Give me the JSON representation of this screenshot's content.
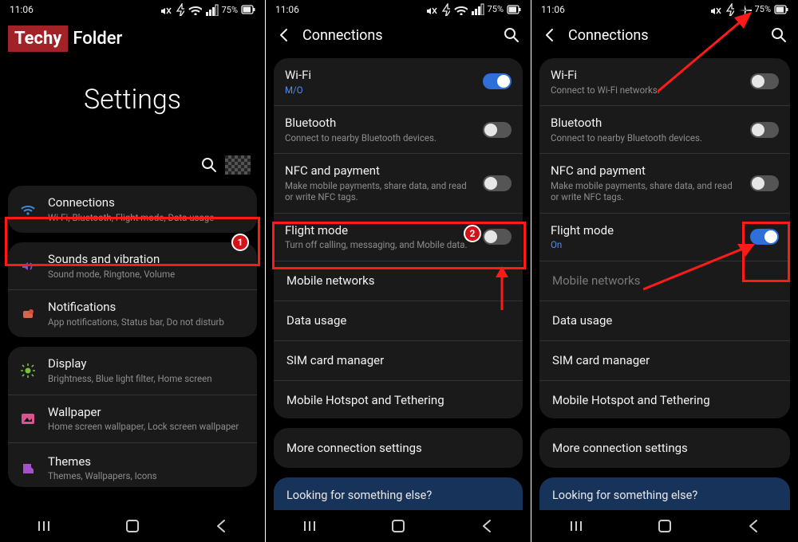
{
  "status": {
    "time": "11:06",
    "battery_pct": "75%"
  },
  "logo": {
    "red": "Techy",
    "rest": "Folder"
  },
  "settings_header": "Settings",
  "phone1": {
    "groups": [
      {
        "items": [
          {
            "key": "connections",
            "title": "Connections",
            "sub": "Wi-Fi, Bluetooth, Flight mode, Data usage",
            "icon": "wifi"
          }
        ]
      },
      {
        "items": [
          {
            "key": "sounds",
            "title": "Sounds and vibration",
            "sub": "Sound mode, Ringtone, Volume",
            "icon": "sound"
          },
          {
            "key": "notifications",
            "title": "Notifications",
            "sub": "App notifications, Status bar, Do not disturb",
            "icon": "notif"
          }
        ]
      },
      {
        "items": [
          {
            "key": "display",
            "title": "Display",
            "sub": "Brightness, Blue light filter, Home screen",
            "icon": "display"
          },
          {
            "key": "wallpaper",
            "title": "Wallpaper",
            "sub": "Home screen wallpaper, Lock screen wallpaper",
            "icon": "wallpaper"
          },
          {
            "key": "themes",
            "title": "Themes",
            "sub": "Themes, Wallpapers, Icons",
            "icon": "themes"
          }
        ]
      }
    ]
  },
  "connections_title": "Connections",
  "phone2": {
    "rows": [
      {
        "title": "Wi-Fi",
        "sub": "M/O",
        "sub_blue": true,
        "toggle": "on"
      },
      {
        "title": "Bluetooth",
        "sub": "Connect to nearby Bluetooth devices.",
        "toggle": "off"
      },
      {
        "title": "NFC and payment",
        "sub": "Make mobile payments, share data, and read or write NFC tags.",
        "toggle": "off"
      },
      {
        "title": "Flight mode",
        "sub": "Turn off calling, messaging, and Mobile data.",
        "toggle": "off"
      },
      {
        "title": "Mobile networks"
      },
      {
        "title": "Data usage"
      },
      {
        "title": "SIM card manager"
      },
      {
        "title": "Mobile Hotspot and Tethering"
      }
    ],
    "more": "More connection settings",
    "looking": "Looking for something else?"
  },
  "phone3": {
    "rows": [
      {
        "title": "Wi-Fi",
        "sub": "Connect to Wi-Fi networks.",
        "toggle": "off"
      },
      {
        "title": "Bluetooth",
        "sub": "Connect to nearby Bluetooth devices.",
        "toggle": "off"
      },
      {
        "title": "NFC and payment",
        "sub": "Make mobile payments, share data, and read or write NFC tags.",
        "toggle": "off"
      },
      {
        "title": "Flight mode",
        "sub": "On",
        "sub_blue": true,
        "toggle": "on"
      },
      {
        "title": "Mobile networks",
        "muted": true
      },
      {
        "title": "Data usage"
      },
      {
        "title": "SIM card manager"
      },
      {
        "title": "Mobile Hotspot and Tethering"
      }
    ],
    "more": "More connection settings",
    "looking": "Looking for something else?"
  },
  "badges": {
    "one": "1",
    "two": "2"
  }
}
